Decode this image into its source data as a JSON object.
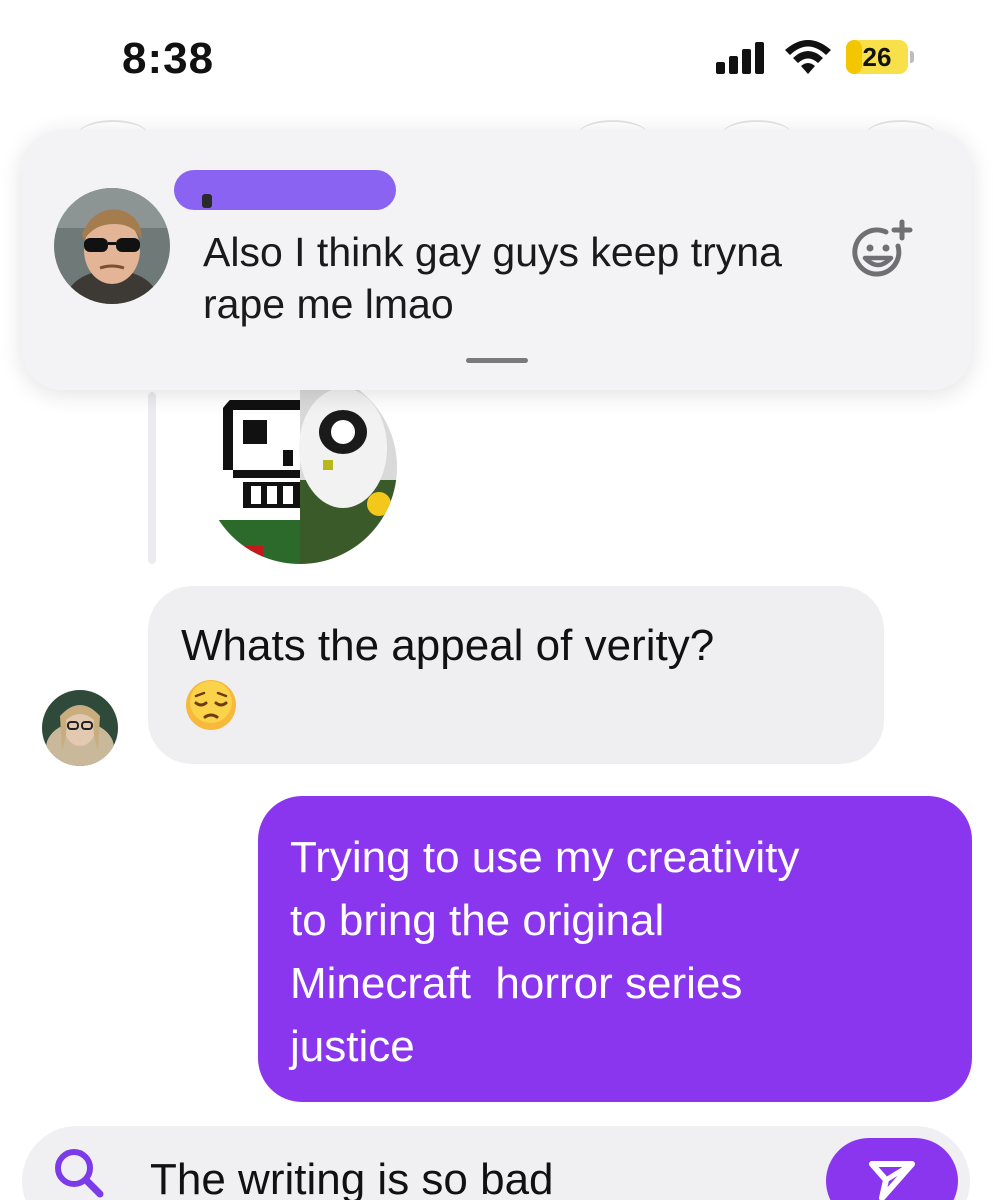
{
  "status_bar": {
    "time": "8:38",
    "battery_level": "26",
    "battery_fraction": 0.26,
    "signal_bars": 4,
    "wifi": true
  },
  "notification": {
    "sender_redacted": true,
    "message": "Also I think gay guys keep tryna rape me lmao",
    "react_icon": "add-emoji-icon"
  },
  "conversation": {
    "incoming": {
      "text": "Whats the appeal of verity?",
      "emoji": "😔"
    },
    "outgoing": {
      "text": "Trying to use my creativity\nto bring the original\nMinecraft  horror series\njustice"
    }
  },
  "composer": {
    "draft": "The writing is so bad",
    "search_icon": "search-icon",
    "send_icon": "send-icon"
  },
  "colors": {
    "accent": "#8a36ef",
    "incoming_bubble": "#efeff2",
    "redaction": "#8a63f2",
    "battery": "#f2c600"
  }
}
